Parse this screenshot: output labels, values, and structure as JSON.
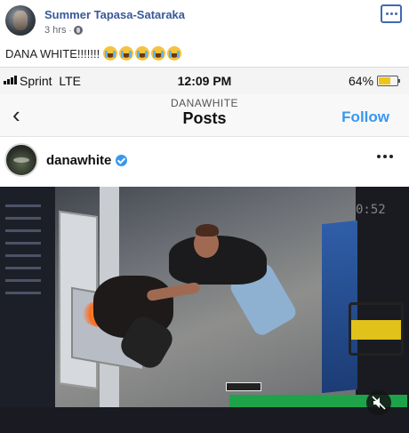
{
  "fb_post": {
    "author": "Summer Tapasa-Sataraka",
    "time": "3 hrs",
    "separator": "·",
    "text": "DANA WHITE!!!!!!!",
    "emoji": [
      "crying-face",
      "crying-face",
      "crying-face",
      "crying-face",
      "crying-face"
    ]
  },
  "phone_status": {
    "carrier": "Sprint",
    "network": "LTE",
    "time": "12:09 PM",
    "battery": "64%",
    "battery_level": 0.64,
    "battery_color": "#f0c419"
  },
  "ig_nav": {
    "username": "DANAWHITE",
    "title": "Posts",
    "follow": "Follow",
    "follow_color": "#3897f0"
  },
  "ig_post": {
    "username": "danawhite",
    "verified": true
  },
  "video": {
    "timestamp": "0:52",
    "muted": true
  },
  "colors": {
    "fb_link": "#385898",
    "fb_accent": "#4267b2"
  }
}
